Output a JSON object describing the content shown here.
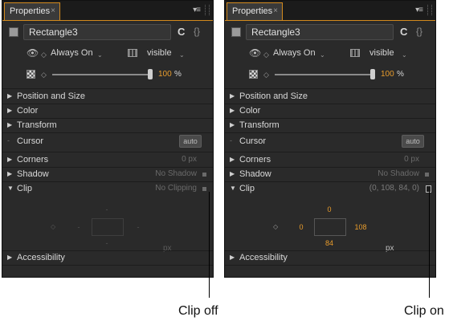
{
  "panels": [
    {
      "tab_label": "Properties",
      "tab_close": "×",
      "menu_icon": "▾≡",
      "object_name": "Rectangle3",
      "c_icon": "C",
      "braces_icon": "{}",
      "visibility_mode": "Always On",
      "visibility": "visible",
      "opacity_value": 100,
      "opacity_unit": "%",
      "opacity_level": 1.0,
      "sections": {
        "position_size": "Position and Size",
        "color": "Color",
        "transform": "Transform",
        "cursor": "Cursor",
        "cursor_button": "auto",
        "corners": "Corners",
        "corners_value": "0 px",
        "shadow": "Shadow",
        "shadow_value": "No Shadow",
        "clip": "Clip",
        "clip_value": "No Clipping",
        "accessibility": "Accessibility"
      },
      "clip_box": {
        "top": "-",
        "right": "-",
        "bottom": "-",
        "left": "-",
        "unit": "px"
      }
    },
    {
      "tab_label": "Properties",
      "tab_close": "×",
      "menu_icon": "▾≡",
      "object_name": "Rectangle3",
      "c_icon": "C",
      "braces_icon": "{}",
      "visibility_mode": "Always On",
      "visibility": "visible",
      "opacity_value": 100,
      "opacity_unit": "%",
      "opacity_level": 1.0,
      "sections": {
        "position_size": "Position and Size",
        "color": "Color",
        "transform": "Transform",
        "cursor": "Cursor",
        "cursor_button": "auto",
        "corners": "Corners",
        "corners_value": "0 px",
        "shadow": "Shadow",
        "shadow_value": "No Shadow",
        "clip": "Clip",
        "clip_value": "(0, 108, 84, 0)",
        "accessibility": "Accessibility"
      },
      "clip_box": {
        "top": "0",
        "right": "108",
        "bottom": "84",
        "left": "0",
        "unit": "px"
      }
    }
  ],
  "captions": {
    "left": "Clip off",
    "right": "Clip on"
  },
  "colors": {
    "accent": "#d38a1e",
    "value_orange": "#e89c2c",
    "panel_bg": "#2a2a2a"
  }
}
